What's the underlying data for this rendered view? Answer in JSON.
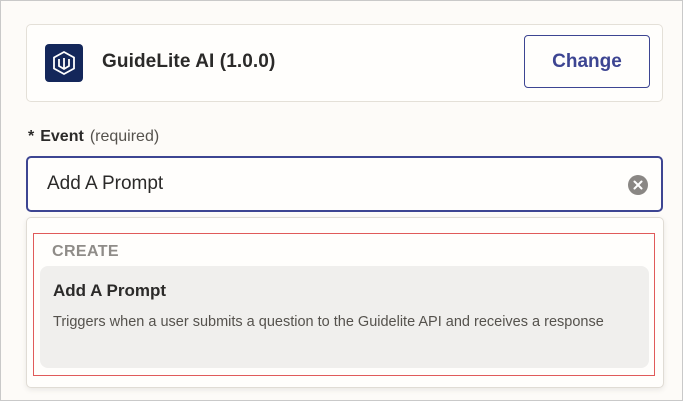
{
  "app": {
    "name": "GuideLite AI (1.0.0)",
    "logo_icon": "guidelite-logo-icon",
    "logo_color": "#14275a",
    "change_label": "Change"
  },
  "event": {
    "required_marker": "*",
    "label": "Event",
    "required_text": "(required)",
    "value": "Add A Prompt",
    "clear_icon": "clear-circle-x-icon"
  },
  "dropdown": {
    "group_heading": "CREATE",
    "options": [
      {
        "title": "Add A Prompt",
        "description": "Triggers when a user submits a question to the Guidelite API and receives a response"
      }
    ]
  },
  "colors": {
    "accent": "#3d4592",
    "highlight_border": "#e05a5a",
    "option_bg": "#f0efed"
  }
}
